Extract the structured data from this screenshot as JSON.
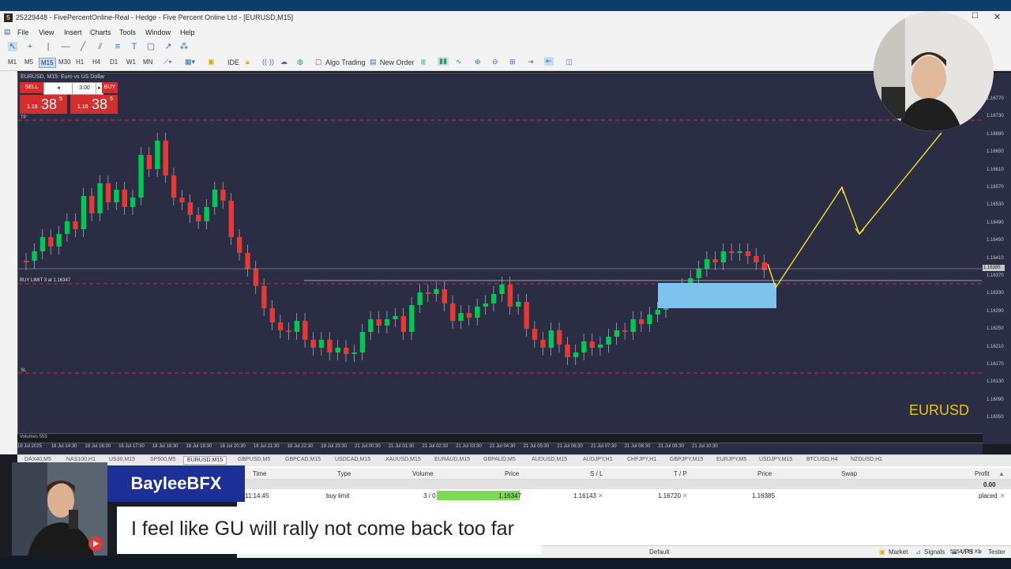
{
  "window": {
    "title": "25229448 - FivePercentOnline-Real - Hedge - Five Percent Online Ltd - [EURUSD,M15]"
  },
  "menu": [
    "File",
    "View",
    "Insert",
    "Charts",
    "Tools",
    "Window",
    "Help"
  ],
  "timeframes": [
    "M1",
    "M5",
    "M15",
    "M30",
    "H1",
    "H4",
    "D1",
    "W1",
    "MN"
  ],
  "selected_timeframe": "M15",
  "toolbar": {
    "ide_label": "IDE",
    "algo_trading_label": "Algo Trading",
    "new_order_label": "New Order"
  },
  "chart": {
    "header": "EURUSD, M15: Euro vs US Dollar",
    "symbol_watermark": "EURUSD",
    "buy_limit_label": "BUY LIMIT 3 at 1.16347",
    "tp_label": "TP",
    "sl_label": "SL",
    "volumes_label": "Volumes 553",
    "current_price_label": "1.16385",
    "price_axis": [
      "1.16770",
      "1.16730",
      "1.16690",
      "1.16650",
      "1.16610",
      "1.16570",
      "1.16530",
      "1.16490",
      "1.16450",
      "1.16410",
      "1.16370",
      "1.16330",
      "1.16290",
      "1.16250",
      "1.16210",
      "1.16170",
      "1.16130",
      "1.16090",
      "1.16050"
    ],
    "time_axis": [
      "18 Jul 2025",
      "18 Jul 14:30",
      "18 Jul 16:30",
      "18 Jul 17:30",
      "18 Jul 18:30",
      "18 Jul 19:30",
      "18 Jul 20:30",
      "18 Jul 21:30",
      "18 Jul 22:30",
      "18 Jul 23:30",
      "21 Jul 00:30",
      "21 Jul 01:30",
      "21 Jul 02:30",
      "21 Jul 03:30",
      "21 Jul 04:30",
      "21 Jul 05:30",
      "21 Jul 06:30",
      "21 Jul 07:30",
      "21 Jul 08:30",
      "21 Jul 09:30",
      "21 Jul 10:30"
    ]
  },
  "trade_panel": {
    "sell_label": "SELL",
    "buy_label": "BUY",
    "lot": "3.00",
    "sell_price_big": "38",
    "sell_price_prefix": "1.16",
    "sell_price_sup": "5",
    "buy_price_big": "38",
    "buy_price_prefix": "1.16",
    "buy_price_sup": "5"
  },
  "tabs": [
    "DAX40,M5",
    "NAS100,H1",
    "US30,M15",
    "SP500,M5",
    "EURUSD,M15",
    "GBPUSD,M5",
    "GBPCAD,M15",
    "USDCAD,M15",
    "XAUUSD,M15",
    "EURAUD,M15",
    "GBPAUD,M5",
    "AUDUSD,M15",
    "AUDJPY,H1",
    "CHFJPY,H1",
    "GBPJPY,M15",
    "EURJPY,M5",
    "USDJPY,M15",
    "BTCUSD,H4",
    "NZDUSD,H1"
  ],
  "selected_tab": "EURUSD,M15",
  "terminal": {
    "headers": [
      "Time",
      "Type",
      "Volume",
      "Price",
      "S / L",
      "T / P",
      "Price",
      "Swap",
      "Profit"
    ],
    "profit_total": "0.00",
    "row": {
      "time": "11:14:45",
      "type": "buy limit",
      "volume": "3 / 0",
      "price": "1.16347",
      "sl": "1.16143",
      "tp": "1.16720",
      "current_price": "1.16385",
      "status": "placed"
    }
  },
  "status": {
    "market": "Market",
    "signals": "Signals",
    "vps": "VPS",
    "tester": "Tester",
    "profile": "Default",
    "traffic": "5954 / 14 Kb"
  },
  "overlay": {
    "name": "BayleeBFX",
    "caption": "I feel like GU will rally not come back too far"
  },
  "colors": {
    "bull": "#00c853",
    "bear": "#e53935",
    "chart_bg": "#2a2d44",
    "zone": "#7ec3ee",
    "arrow": "#f5e02a",
    "name_bg": "#1c2f97"
  }
}
